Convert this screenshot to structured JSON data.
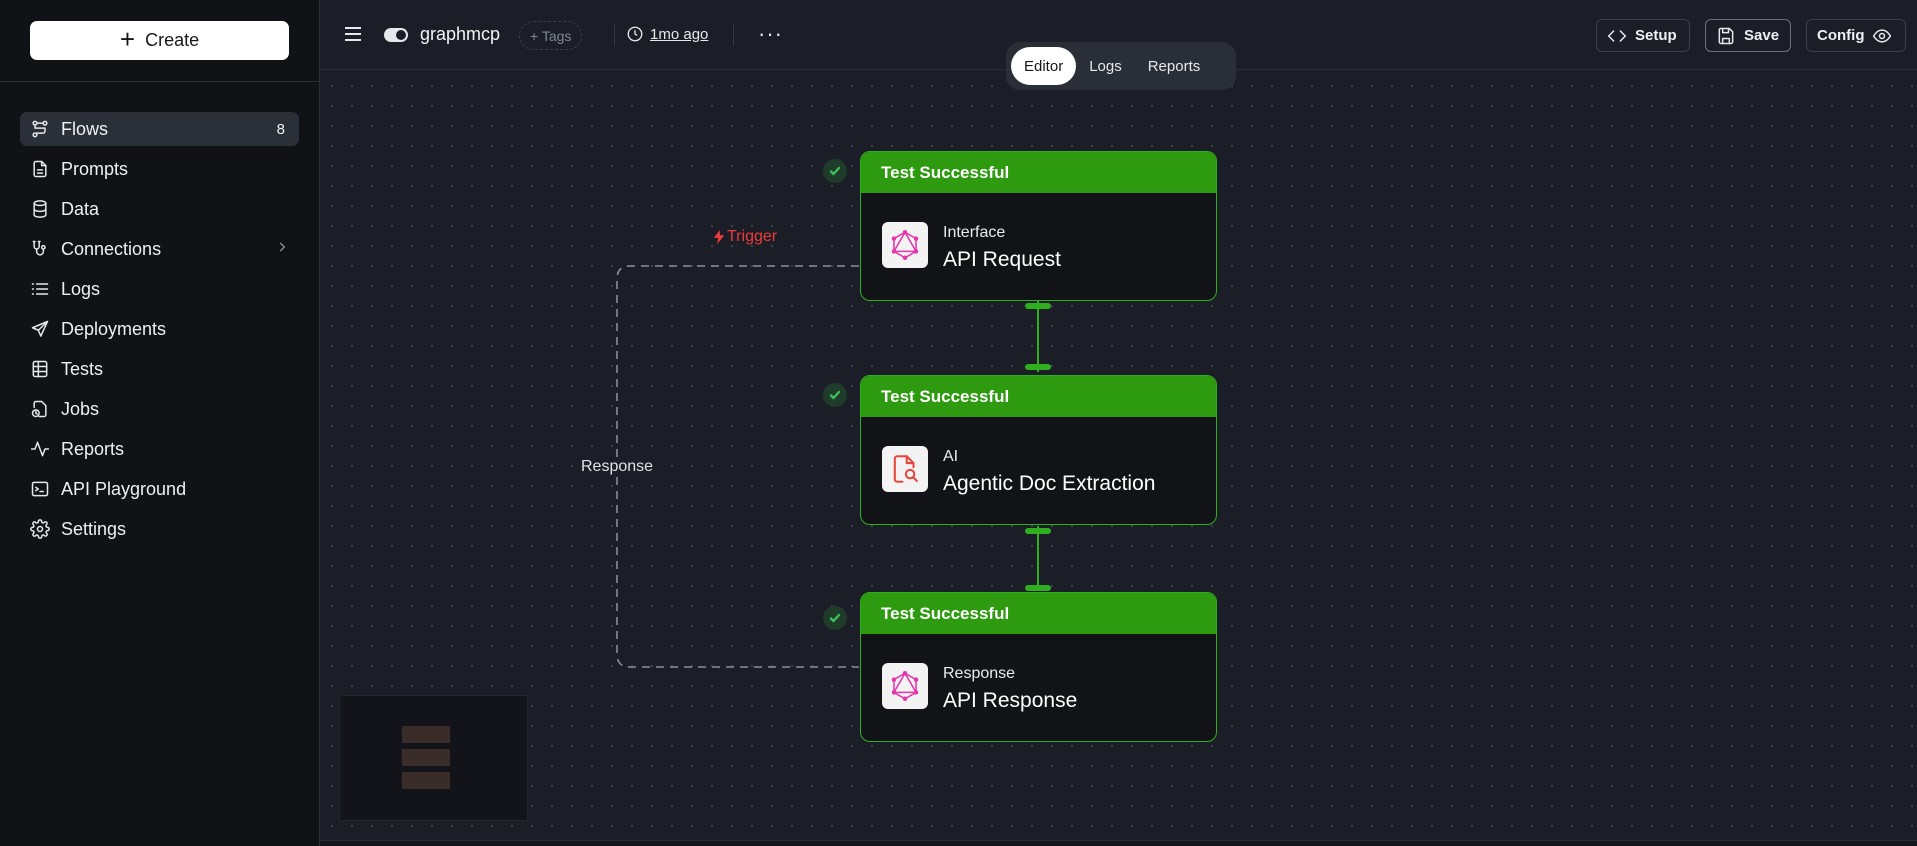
{
  "sidebar": {
    "create_label": "Create",
    "items": [
      {
        "label": "Flows",
        "icon": "flows-icon",
        "count": "8",
        "active": true
      },
      {
        "label": "Prompts",
        "icon": "document-icon"
      },
      {
        "label": "Data",
        "icon": "database-icon"
      },
      {
        "label": "Connections",
        "icon": "connections-icon",
        "has_submenu": true
      },
      {
        "label": "Logs",
        "icon": "list-icon"
      },
      {
        "label": "Deployments",
        "icon": "send-icon"
      },
      {
        "label": "Tests",
        "icon": "table-icon"
      },
      {
        "label": "Jobs",
        "icon": "jobs-icon"
      },
      {
        "label": "Reports",
        "icon": "activity-icon"
      },
      {
        "label": "API Playground",
        "icon": "terminal-icon"
      },
      {
        "label": "Settings",
        "icon": "gear-icon"
      }
    ]
  },
  "topbar": {
    "flow_name": "graphmcp",
    "tags_label": "+ Tags",
    "updated": "1mo ago",
    "tabs": [
      {
        "label": "Editor",
        "active": true
      },
      {
        "label": "Logs"
      },
      {
        "label": "Reports"
      }
    ],
    "setup_label": "Setup",
    "save_label": "Save",
    "config_label": "Config"
  },
  "canvas": {
    "trigger_label": "Trigger",
    "response_label": "Response",
    "nodes": [
      {
        "status": "Test Successful",
        "kind": "Interface",
        "title": "API Request",
        "icon": "graphql-icon"
      },
      {
        "status": "Test Successful",
        "kind": "AI",
        "title": "Agentic Doc Extraction",
        "icon": "doc-search-icon"
      },
      {
        "status": "Test Successful",
        "kind": "Response",
        "title": "API Response",
        "icon": "graphql-icon"
      }
    ]
  },
  "colors": {
    "success_green": "#2d9a0f",
    "node_border": "#2fae1f",
    "trigger_red": "#ef3b3b",
    "graphql_pink": "#e535ab",
    "doc_red": "#e8453c"
  }
}
